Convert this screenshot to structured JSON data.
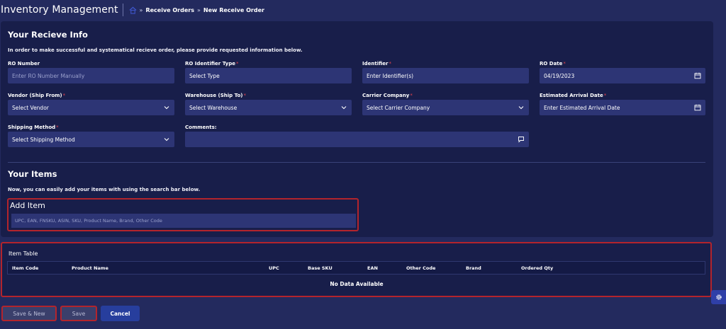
{
  "header": {
    "app_title": "Inventory Management",
    "breadcrumbs": [
      "Receive Orders",
      "New Receive Order"
    ],
    "crumb_separator": "»"
  },
  "receive_info": {
    "title": "Your Recieve Info",
    "description": "In order to make successful and systematical recieve order, please provide requested information below.",
    "fields": {
      "ro_number": {
        "label": "RO Number",
        "required": false,
        "placeholder": "Enter RO Number Manually",
        "value": ""
      },
      "ro_identifier_type": {
        "label": "RO Identifier Type",
        "required": true,
        "value": "Select Type"
      },
      "identifier": {
        "label": "Identifier",
        "required": true,
        "value": "Enter Identifier(s)"
      },
      "ro_date": {
        "label": "RO Date",
        "required": true,
        "value": "04/19/2023"
      },
      "vendor": {
        "label": "Vendor (Ship From)",
        "required": true,
        "value": "Select Vendor"
      },
      "warehouse": {
        "label": "Warehouse (Ship To)",
        "required": true,
        "value": "Select Warehouse"
      },
      "carrier": {
        "label": "Carrier Company",
        "required": true,
        "value": "Select Carrier Company"
      },
      "eta": {
        "label": "Estimated Arrival Date",
        "required": true,
        "value": "Enter Estimated Arrival Date"
      },
      "shipping_method": {
        "label": "Shipping Method",
        "required": true,
        "value": "Select Shipping Method"
      },
      "comments": {
        "label": "Comments:",
        "required": false,
        "value": ""
      }
    }
  },
  "items": {
    "title": "Your Items",
    "description": "Now, you can easily add your items with using the search bar below.",
    "add_item_title": "Add Item",
    "search_placeholder": "UPC, EAN, FNSKU, ASIN, SKU, Product Name, Brand, Other Code"
  },
  "item_table": {
    "title": "Item Table",
    "columns": [
      "Item Code",
      "Product Name",
      "UPC",
      "Base SKU",
      "EAN",
      "Other Code",
      "Brand",
      "Ordered Qty"
    ],
    "empty_text": "No Data Available"
  },
  "actions": {
    "save_new": "Save & New",
    "save": "Save",
    "cancel": "Cancel"
  },
  "icons": {
    "home": "home-icon",
    "calendar": "calendar-icon",
    "chevron": "chevron-down-icon",
    "comment": "comment-icon",
    "settings": "gear-icon"
  },
  "colors": {
    "page_bg": "#232a5e",
    "card_bg": "#181e4a",
    "field_bg": "#2d3575",
    "required_marker": "#e2434d",
    "highlight_border": "#b3242c",
    "primary_button": "#273e9d",
    "settings_button": "#2f3fa8"
  }
}
